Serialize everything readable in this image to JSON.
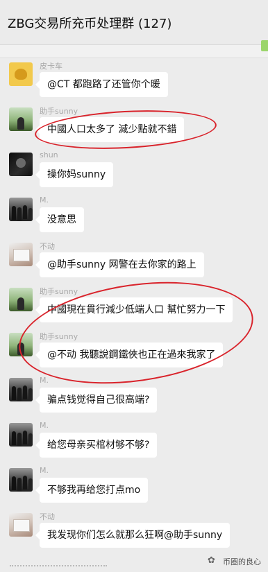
{
  "header": {
    "title": "ZBG交易所充币处理群 (127)"
  },
  "messages": [
    {
      "sender": "皮卡车",
      "text": "@CT 都跑路了还管你个暖",
      "avatar": "yellow-cartoon-avatar"
    },
    {
      "sender": "助手sunny",
      "text": "中國人口太多了 減少點就不錯",
      "avatar": "field-photo-avatar"
    },
    {
      "sender": "shun",
      "text": "操你妈sunny",
      "avatar": "dark-portrait-avatar"
    },
    {
      "sender": "M.",
      "text": "没意思",
      "avatar": "crowd-photo-avatar"
    },
    {
      "sender": "不动",
      "text": "@助手sunny 网警在去你家的路上",
      "avatar": "pale-photo-avatar"
    },
    {
      "sender": "助手sunny",
      "text": "中國現在貫行減少低端人口 幫忙努力一下",
      "avatar": "field-photo-avatar"
    },
    {
      "sender": "助手sunny",
      "text": "@不动 我聽說鋼鐵俠也正在過來我家了",
      "avatar": "field-photo-avatar"
    },
    {
      "sender": "M.",
      "text": "骗点钱觉得自己很高端?",
      "avatar": "crowd-photo-avatar"
    },
    {
      "sender": "M.",
      "text": "给您母亲买棺材够不够?",
      "avatar": "crowd-photo-avatar"
    },
    {
      "sender": "M.",
      "text": "不够我再给您打点mo",
      "avatar": "crowd-photo-avatar"
    },
    {
      "sender": "不动",
      "text": "我发现你们怎么就那么狂啊@助手sunny",
      "avatar": "pale-photo-avatar"
    }
  ],
  "footer": {
    "watermark": "币圈的良心",
    "icon": "wechat-icon"
  },
  "colors": {
    "annotation": "#d9232b",
    "bubble": "#ffffff",
    "background": "#ececec"
  }
}
